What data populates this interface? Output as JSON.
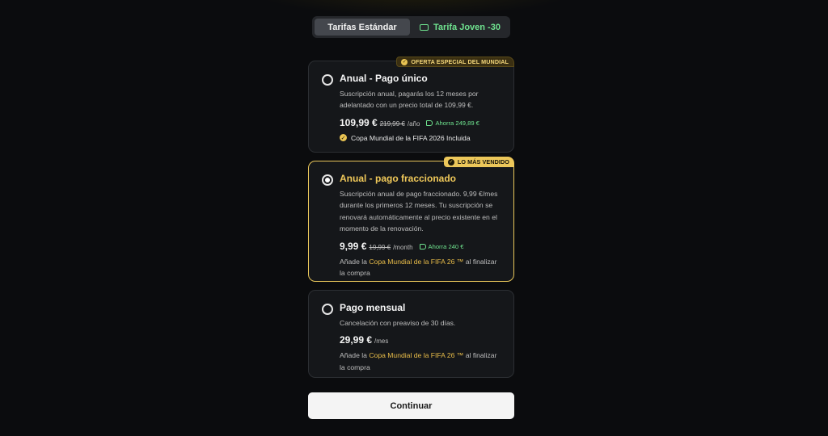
{
  "tabs": [
    {
      "label": "Tarifas Estándar",
      "active": true
    },
    {
      "label": "Tarifa Joven -30",
      "active": false,
      "icon": "ticket-icon"
    }
  ],
  "plans": [
    {
      "badge": "OFERTA ESPECIAL DEL MUNDIAL",
      "title": "Anual - Pago único",
      "description": "Suscripción anual, pagarás los 12 meses por adelantado con un precio total de 109,99 €.",
      "price": "109,99 €",
      "old_price": "219,99 €",
      "period": "/año",
      "savings": "Ahorra 249,89 €",
      "included": "Copa Mundial de la FIFA 2026 Incluida",
      "selected": false
    },
    {
      "badge": "LO MÁS VENDIDO",
      "title": "Anual - pago fraccionado",
      "description": "Suscripción anual de pago fraccionado. 9,99 €/mes durante los primeros 12 meses. Tu suscripción se renovará automáticamente al precio existente en el momento de la renovación.",
      "price": "9,99 €",
      "old_price": "19,99 €",
      "period": "/month",
      "savings": "Ahorra 240 €",
      "addon_prefix": "Añade la ",
      "addon_highlight": "Copa Mundial de la FIFA 26 ™",
      "addon_suffix": " al finalizar la compra",
      "selected": true
    },
    {
      "title": "Pago mensual",
      "description": "Cancelación con preaviso de 30 días.",
      "price": "29,99 €",
      "period": "/mes",
      "addon_prefix": "Añade la ",
      "addon_highlight": "Copa Mundial de la FIFA 26 ™",
      "addon_suffix": " al finalizar la compra",
      "selected": false
    }
  ],
  "continue_label": "Continuar",
  "colors": {
    "accent_gold": "#ecc75a",
    "savings_green": "#6fe38f",
    "background": "#0b0c0e"
  }
}
